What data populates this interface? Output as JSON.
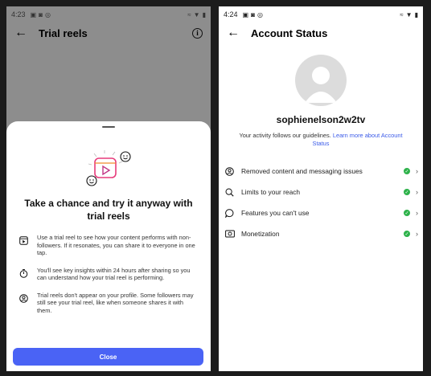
{
  "left": {
    "status_time": "4:23",
    "title": "Trial reels",
    "sheet": {
      "heading": "Take a chance and try it anyway with trial reels",
      "features": [
        {
          "icon": "reel-icon",
          "text": "Use a trial reel to see how your content performs with non-followers. If it resonates, you can share it to everyone in one tap."
        },
        {
          "icon": "timer-icon",
          "text": "You'll see key insights within 24 hours after sharing so you can understand how your trial reel is performing."
        },
        {
          "icon": "profile-icon",
          "text": "Trial reels don't appear on your profile. Some followers may still see your trial reel, like when someone shares it with them."
        }
      ],
      "close_label": "Close"
    }
  },
  "right": {
    "status_time": "4:24",
    "title": "Account Status",
    "username": "sophienelson2w2tv",
    "guideline_text": "Your activity follows our guidelines.",
    "guideline_link": "Learn more about Account Status",
    "rows": [
      {
        "icon": "removed-content-icon",
        "label": "Removed content and messaging issues",
        "status": "ok"
      },
      {
        "icon": "search-icon",
        "label": "Limits to your reach",
        "status": "ok"
      },
      {
        "icon": "speech-bubble-icon",
        "label": "Features you can't use",
        "status": "ok"
      },
      {
        "icon": "monetization-icon",
        "label": "Monetization",
        "status": "ok"
      }
    ]
  },
  "colors": {
    "accent": "#4a63f5",
    "check_green": "#2db24a",
    "link": "#3a5ae8"
  }
}
